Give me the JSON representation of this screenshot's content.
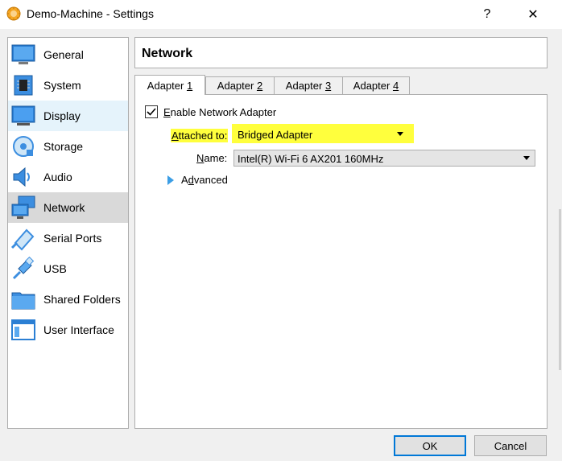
{
  "window": {
    "title": "Demo-Machine - Settings",
    "help_label": "?",
    "close_label": "✕"
  },
  "sidebar": {
    "items": [
      {
        "label": "General",
        "icon": "general-icon",
        "state": "normal"
      },
      {
        "label": "System",
        "icon": "system-icon",
        "state": "normal"
      },
      {
        "label": "Display",
        "icon": "display-icon",
        "state": "hover"
      },
      {
        "label": "Storage",
        "icon": "storage-icon",
        "state": "normal"
      },
      {
        "label": "Audio",
        "icon": "audio-icon",
        "state": "normal"
      },
      {
        "label": "Network",
        "icon": "network-icon",
        "state": "selected"
      },
      {
        "label": "Serial Ports",
        "icon": "serial-ports-icon",
        "state": "normal"
      },
      {
        "label": "USB",
        "icon": "usb-icon",
        "state": "normal"
      },
      {
        "label": "Shared Folders",
        "icon": "shared-folders-icon",
        "state": "normal"
      },
      {
        "label": "User Interface",
        "icon": "user-interface-icon",
        "state": "normal"
      }
    ]
  },
  "page": {
    "title": "Network"
  },
  "tabs": [
    {
      "prefix": "Adapter ",
      "key": "1",
      "active": true
    },
    {
      "prefix": "Adapter ",
      "key": "2",
      "active": false
    },
    {
      "prefix": "Adapter ",
      "key": "3",
      "active": false
    },
    {
      "prefix": "Adapter ",
      "key": "4",
      "active": false
    }
  ],
  "adapter": {
    "enable_label_key": "E",
    "enable_label_rest": "nable Network Adapter",
    "enabled": true,
    "attached_label_key": "A",
    "attached_label_rest": "ttached to:",
    "attached_value": "Bridged Adapter",
    "name_label_key": "N",
    "name_label_rest": "ame:",
    "name_value": "Intel(R) Wi-Fi 6 AX201 160MHz",
    "advanced_label_pre": "A",
    "advanced_label_key": "d",
    "advanced_label_rest": "vanced"
  },
  "colors": {
    "highlight": "#ffff3d",
    "selected_bg": "#d9d9d9",
    "hover_bg": "#e5f3fb",
    "accent": "#0078d7"
  },
  "buttons": {
    "ok": "OK",
    "cancel": "Cancel"
  }
}
